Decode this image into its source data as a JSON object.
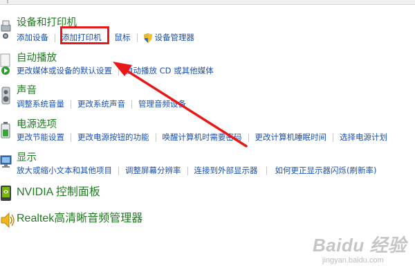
{
  "sections": [
    {
      "title": "设备和打印机",
      "icon": "printer-camera-icon",
      "links": [
        "添加设备",
        "添加打印机",
        "鼠标",
        "设备管理器"
      ]
    },
    {
      "title": "自动播放",
      "icon": "autoplay-icon",
      "links": [
        "更改媒体或设备的默认设置",
        "自动播放 CD 或其他媒体"
      ]
    },
    {
      "title": "声音",
      "icon": "speaker-icon",
      "links": [
        "调整系统音量",
        "更改系统声音",
        "管理音频设备"
      ]
    },
    {
      "title": "电源选项",
      "icon": "battery-icon",
      "links": [
        "更改节能设置",
        "更改电源按钮的功能",
        "唤醒计算机时需要密码",
        "更改计算机睡眠时间",
        "选择电源计划"
      ]
    },
    {
      "title": "显示",
      "icon": "monitor-icon",
      "links": [
        "放大或缩小文本和其他项目",
        "调整屏幕分辨率",
        "连接到外部显示器",
        "如何更正显示器闪烁(刷新率)"
      ]
    },
    {
      "title": "NVIDIA 控制面板",
      "icon": "nvidia-icon",
      "links": []
    },
    {
      "title": "Realtek高清晰音频管理器",
      "icon": "realtek-speaker-icon",
      "links": []
    }
  ],
  "annotation": {
    "box_color": "#e81818",
    "arrow_color": "#e81818"
  },
  "watermark": {
    "main": "Baidu 经验",
    "sub": "jingyan.baidu.com"
  },
  "colors": {
    "title_green": "#1e7a1e",
    "link_blue": "#1a50b0"
  }
}
